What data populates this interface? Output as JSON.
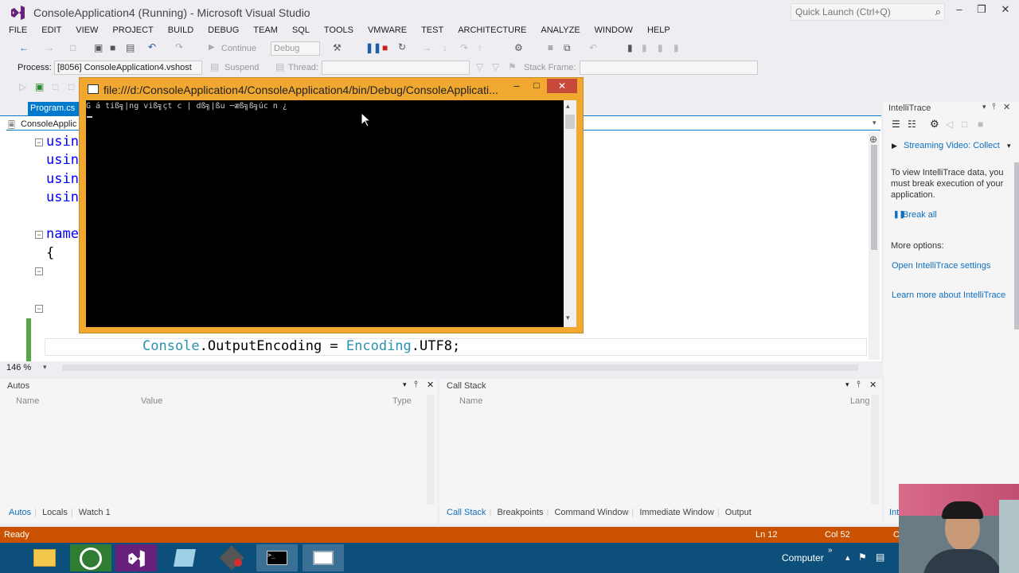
{
  "window": {
    "title": "ConsoleApplication4 (Running) - Microsoft Visual Studio",
    "quick_launch_placeholder": "Quick Launch (Ctrl+Q)"
  },
  "menu": [
    "FILE",
    "EDIT",
    "VIEW",
    "PROJECT",
    "BUILD",
    "DEBUG",
    "TEAM",
    "SQL",
    "TOOLS",
    "VMWARE",
    "TEST",
    "ARCHITECTURE",
    "ANALYZE",
    "WINDOW",
    "HELP"
  ],
  "toolbar": {
    "continue_label": "Continue",
    "config_value": "Debug",
    "process_label": "Process:",
    "process_value": "[8056] ConsoleApplication4.vshost",
    "suspend_label": "Suspend",
    "thread_label": "Thread:",
    "stackframe_label": "Stack Frame:"
  },
  "editor": {
    "tab_label": "Program.cs",
    "nav_left": "ConsoleApplic",
    "zoom": "146 %",
    "lines": {
      "using1": "usin",
      "using2": "usin",
      "using3": "usin",
      "using4": "usin",
      "namespace": "name",
      "brace": "{",
      "console": "Console",
      "output_encoding": ".OutputEncoding = ",
      "encoding": "Encoding",
      "utf8": ".UTF8;"
    }
  },
  "console": {
    "title": "file:///d:/ConsoleApplication4/ConsoleApplication4/bin/Debug/ConsoleApplicati...",
    "output": "G á tiß╗|ng viß╗çt c | dß╗|ßu ─æß╗ß╗úc n ¿"
  },
  "intellitrace": {
    "title": "IntelliTrace",
    "streaming": "Streaming Video: Collect",
    "message": "To view IntelliTrace data, you must break execution of your application.",
    "break_all": "Break all",
    "more_options": "More options:",
    "open_settings": "Open IntelliTrace settings",
    "learn_more": "Learn more about IntelliTrace"
  },
  "autos": {
    "title": "Autos",
    "columns": [
      "Name",
      "Value",
      "Type"
    ],
    "tabs": [
      "Autos",
      "Locals",
      "Watch 1"
    ]
  },
  "callstack": {
    "title": "Call Stack",
    "columns": [
      "Name",
      "Lang"
    ],
    "tabs": [
      "Call Stack",
      "Breakpoints",
      "Command Window",
      "Immediate Window",
      "Output"
    ]
  },
  "right_tab_fragment": "Int",
  "status": {
    "ready": "Ready",
    "ln": "Ln 12",
    "col": "Col 52",
    "ch": "C"
  },
  "taskbar": {
    "computer_label": "Computer"
  },
  "colors": {
    "accent": "#007acc",
    "status_bar": "#ca5100",
    "console_frame": "#f0a830",
    "taskbar": "#0c4f7a"
  }
}
